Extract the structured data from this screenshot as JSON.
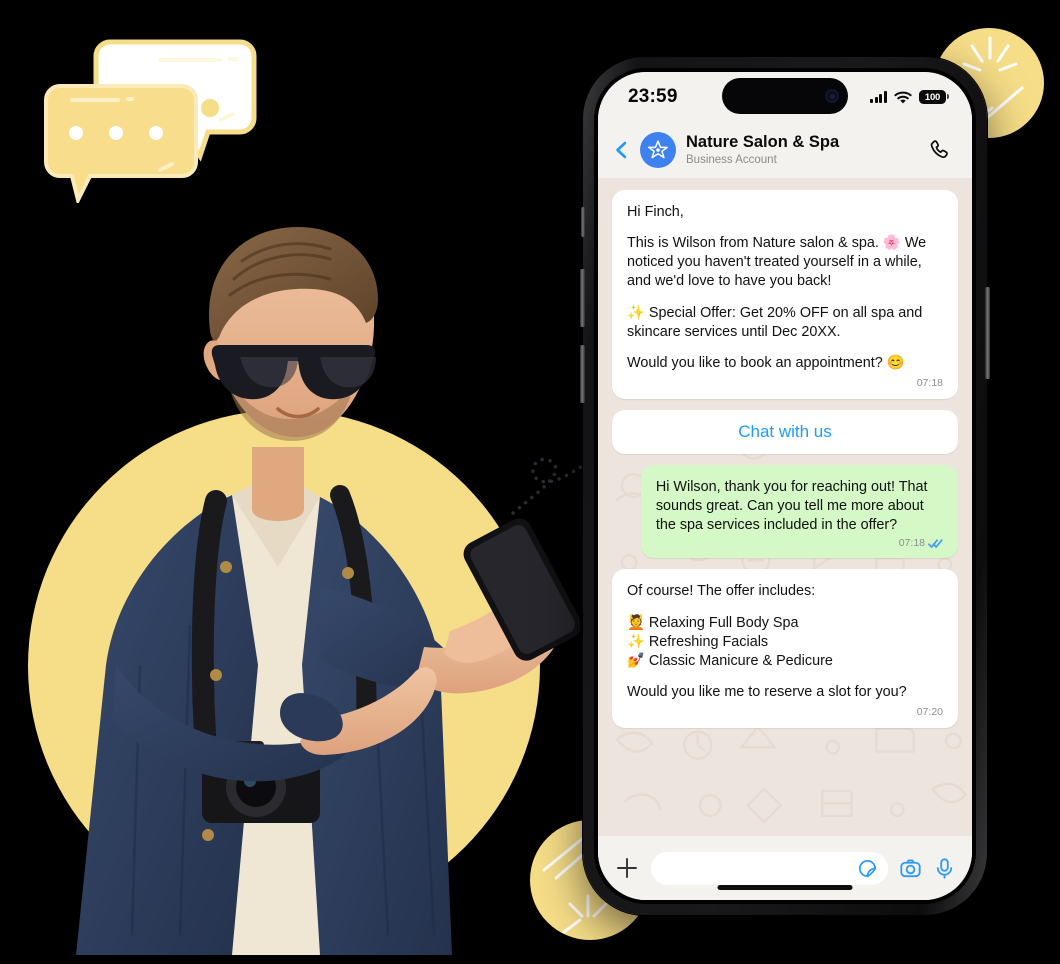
{
  "colors": {
    "accent_yellow": "#F6DD88",
    "brand_blue": "#3E82EF",
    "link_blue": "#1F9BF7",
    "outgoing_green": "#D4F8C6",
    "chat_bg": "#EDE4DD",
    "bar_bg": "#F4F2EF"
  },
  "decorations": {
    "speech_bubbles_alt": "two-overlapping-speech-bubbles",
    "circle_top_right": "yellow-circle-sparkle",
    "circle_bottom_left": "yellow-circle-sparkle",
    "circle_behind_person": "yellow-circle",
    "dotted_connector": "dotted-curly-line"
  },
  "photo": {
    "alt": "Young man with sunglasses, denim shirt, backpack and camera looking at smartphone"
  },
  "phone": {
    "status_bar": {
      "time": "23:59",
      "signal_icon": "cellular-bars-icon",
      "wifi_icon": "wifi-icon",
      "battery_label": "100",
      "battery_icon": "battery-icon",
      "dynamic_island": "dynamic-island"
    },
    "chat_header": {
      "back_icon": "chevron-left-icon",
      "avatar_icon": "flower-avatar-icon",
      "name": "Nature Salon & Spa",
      "subtitle": "Business Account",
      "call_icon": "phone-call-icon"
    },
    "messages": [
      {
        "id": "msg-offer",
        "direction": "incoming",
        "greeting": "Hi Finch,",
        "paragraph1": "This is Wilson from Nature salon & spa. 🌸 We noticed you haven't treated yourself in a while, and we'd love to have you back!",
        "paragraph2": "✨ Special Offer: Get 20% OFF on all spa and skincare services until Dec 20XX.",
        "paragraph3": "Would you like to book an appointment? 😊",
        "time": "07:18"
      },
      {
        "id": "msg-reply",
        "direction": "outgoing",
        "text": "Hi Wilson, thank you for reaching out! That sounds great. Can you tell me more about the spa services included in the offer?",
        "time": "07:18",
        "status_icon": "double-check-read-icon"
      },
      {
        "id": "msg-services",
        "direction": "incoming",
        "intro": "Of course! The offer includes:",
        "items": [
          "💆 Relaxing Full Body Spa",
          "✨ Refreshing Facials",
          "💅 Classic Manicure & Pedicure"
        ],
        "closing": "Would you like me to reserve a slot for you?",
        "time": "07:20"
      }
    ],
    "cta_button": {
      "label": "Chat with us"
    },
    "input_bar": {
      "plus_icon": "plus-icon",
      "placeholder": "",
      "value": "",
      "sticker_icon": "sticker-icon",
      "camera_icon": "camera-icon",
      "mic_icon": "microphone-icon"
    },
    "hardware": {
      "mute_switch": "mute-switch",
      "volume_up": "volume-up-button",
      "volume_down": "volume-down-button",
      "power": "power-button",
      "home_indicator": "home-indicator"
    }
  }
}
